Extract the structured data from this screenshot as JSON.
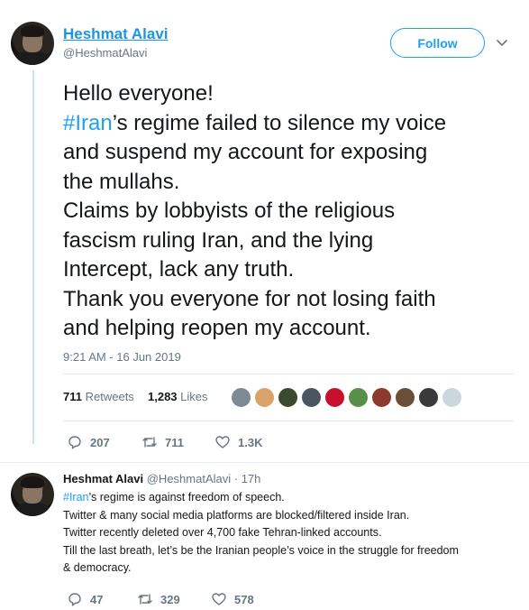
{
  "main_tweet": {
    "author_name": "Heshmat Alavi",
    "author_handle": "@HeshmatAlavi",
    "follow_label": "Follow",
    "text_lines": [
      {
        "before": "Hello everyone!",
        "tag": "",
        "after": ""
      },
      {
        "before": "",
        "tag": "#Iran",
        "after": "’s regime failed to silence my voice"
      },
      {
        "before": "and suspend my account for exposing",
        "tag": "",
        "after": ""
      },
      {
        "before": "the mullahs.",
        "tag": "",
        "after": ""
      },
      {
        "before": "Claims by lobbyists of the religious",
        "tag": "",
        "after": ""
      },
      {
        "before": "fascism ruling Iran, and the lying",
        "tag": "",
        "after": ""
      },
      {
        "before": "Intercept, lack any truth.",
        "tag": "",
        "after": ""
      },
      {
        "before": "Thank you everyone for not losing faith",
        "tag": "",
        "after": ""
      },
      {
        "before": "and helping reopen my account.",
        "tag": "",
        "after": ""
      }
    ],
    "timestamp": "9:21 AM - 16 Jun 2019",
    "retweets_count": "711",
    "retweets_label": "Retweets",
    "likes_count": "1,283",
    "likes_label": "Likes",
    "replies": "207",
    "retweets": "711",
    "likes": "1.3K"
  },
  "liker_avatars": [
    {
      "color": "#7d8a94"
    },
    {
      "color": "#d9a36a"
    },
    {
      "color": "#3b4a2f"
    },
    {
      "color": "#4a5560"
    },
    {
      "color": "#c8102e"
    },
    {
      "color": "#5a8f4a"
    },
    {
      "color": "#8c3a2e"
    },
    {
      "color": "#6a4e3a"
    },
    {
      "color": "#3a3a3a"
    },
    {
      "color": "#ccd6dd"
    }
  ],
  "reply_tweet": {
    "author_name": "Heshmat Alavi",
    "author_handle": "@HeshmatAlavi",
    "age": "· 17h",
    "text_lines": [
      {
        "before": "",
        "tag": "#Iran",
        "after": "’s regime is against freedom of speech."
      },
      {
        "before": "Twitter & many social media platforms are blocked/filtered inside Iran.",
        "tag": "",
        "after": ""
      },
      {
        "before": "Twitter recently deleted over 4,700 fake Tehran-linked accounts.",
        "tag": "",
        "after": ""
      },
      {
        "before": "Till the last breath, let’s be the Iranian people’s voice in the struggle for freedom",
        "tag": "",
        "after": ""
      },
      {
        "before": "& democracy.",
        "tag": "",
        "after": ""
      }
    ],
    "replies": "47",
    "retweets": "329",
    "likes": "578"
  },
  "colors": {
    "link": "#1da1f2",
    "thread_line": "#c6e5f9",
    "muted": "#657786"
  },
  "icons": {
    "reply": "reply-icon",
    "retweet": "retweet-icon",
    "like": "heart-icon",
    "caret": "chevron-down-icon"
  }
}
